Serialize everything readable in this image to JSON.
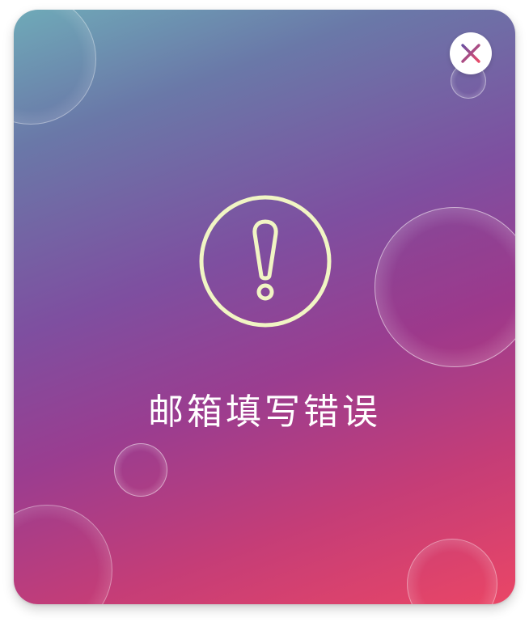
{
  "dialog": {
    "message": "邮箱填写错误",
    "icon": "exclamation-circle-icon",
    "close_icon": "close-icon"
  },
  "colors": {
    "gradient_top": "#6faab8",
    "gradient_mid": "#7e4fa0",
    "gradient_bottom": "#ea4666",
    "icon_stroke": "#f1f5c4",
    "close_x_start": "#6b4fa0",
    "close_x_end": "#e84a68",
    "message_text": "#ffffff"
  }
}
